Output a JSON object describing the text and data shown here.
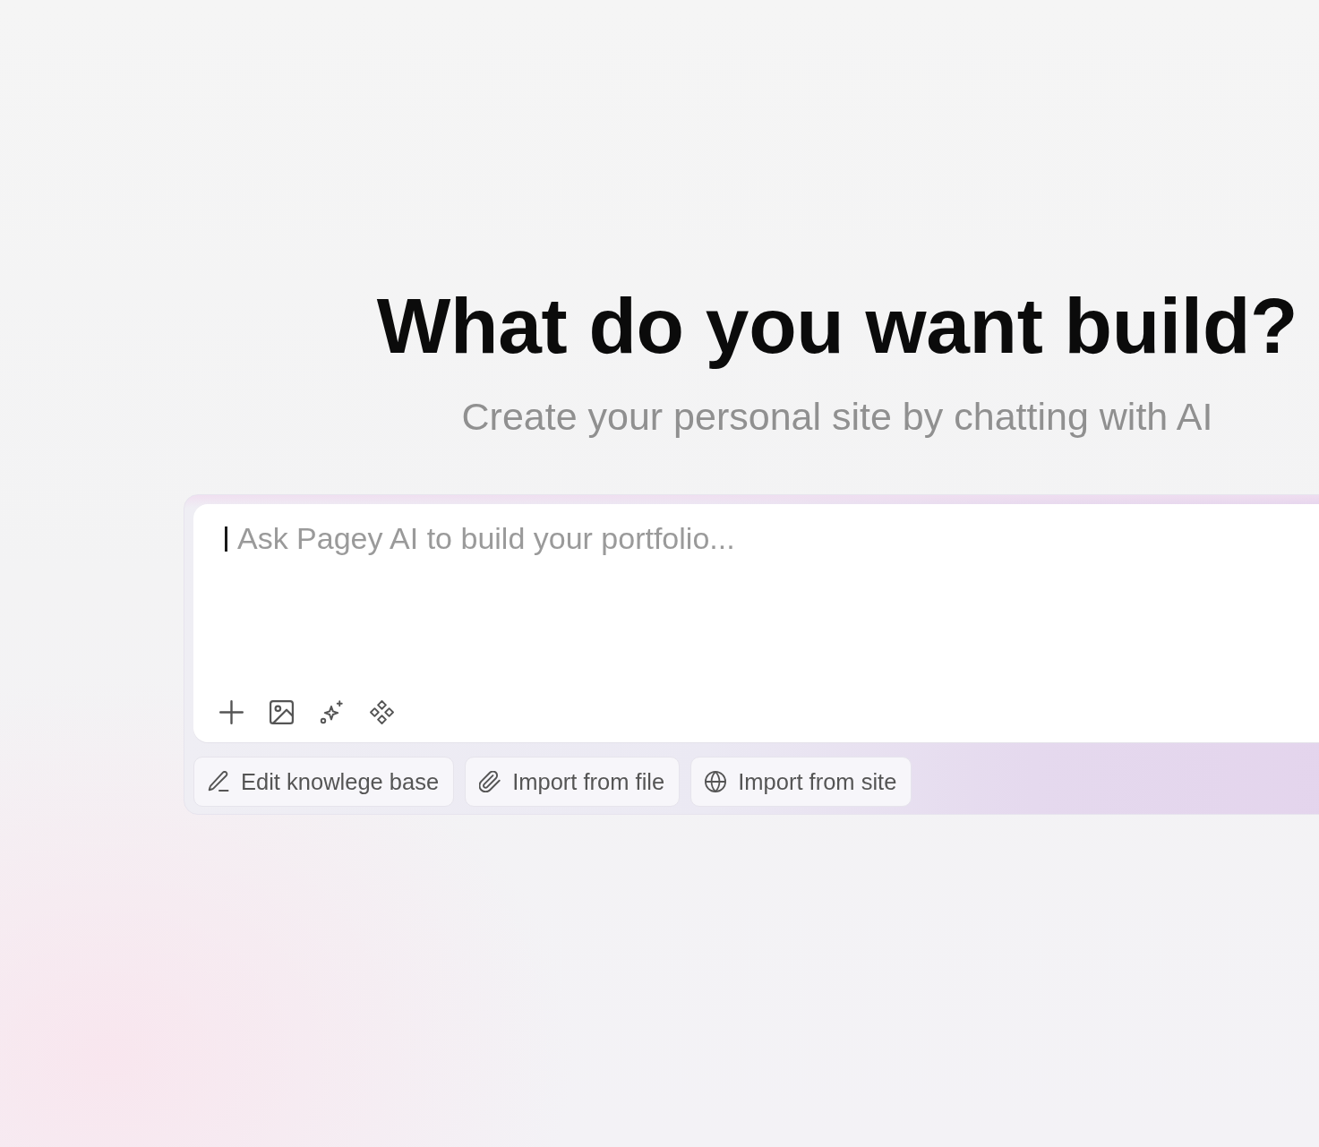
{
  "heading": {
    "title": "What do you want build?",
    "subtitle": "Create your personal site by chatting with AI"
  },
  "composer": {
    "placeholder": "Ask Pagey AI to build your portfolio...",
    "focused": true
  },
  "actions": [
    {
      "label": "Edit knowlege base"
    },
    {
      "label": "Import from file"
    },
    {
      "label": "Import from site"
    }
  ]
}
